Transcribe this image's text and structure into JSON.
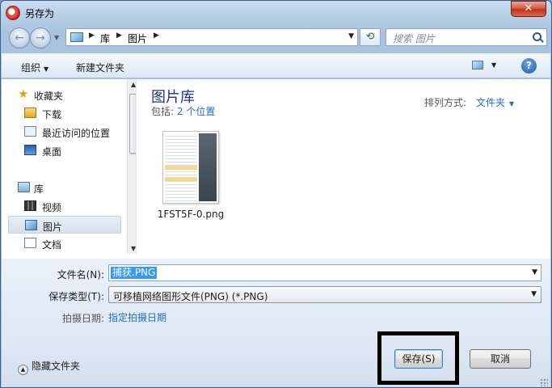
{
  "window": {
    "title": "另存为",
    "close_glyph": "✕",
    "colors": {
      "frame": "#a9c3e0",
      "close": "#c0321a",
      "link": "#1f6fc5",
      "selection": "#3399ff"
    }
  },
  "address": {
    "crumbs": [
      "库",
      "图片"
    ],
    "search_placeholder": "搜索 图片",
    "icons": {
      "back": "back-arrow-icon",
      "forward": "forward-arrow-icon",
      "refresh": "refresh-icon",
      "search": "search-icon"
    }
  },
  "toolbar": {
    "organize": "组织",
    "new_folder": "新建文件夹",
    "help": "?"
  },
  "nav": {
    "items": [
      {
        "label": "收藏夹",
        "icon": "star-icon",
        "group": true
      },
      {
        "label": "下载",
        "icon": "download-folder-icon"
      },
      {
        "label": "最近访问的位置",
        "icon": "recent-places-icon"
      },
      {
        "label": "桌面",
        "icon": "desktop-icon"
      },
      {
        "label": "库",
        "icon": "library-icon",
        "group": true
      },
      {
        "label": "视频",
        "icon": "video-icon"
      },
      {
        "label": "图片",
        "icon": "picture-icon",
        "selected": true
      },
      {
        "label": "文档",
        "icon": "document-icon"
      }
    ]
  },
  "content": {
    "library_title": "图片库",
    "includes_label": "包括:",
    "includes_locations": "2 个位置",
    "sort_label": "排列方式:",
    "sort_value": "文件夹",
    "files": [
      {
        "name": "1FST5F-0.png"
      }
    ]
  },
  "fields": {
    "filename_label": "文件名(N):",
    "filename_value": "捕获.PNG",
    "type_label": "保存类型(T):",
    "type_value": "可移植网络图形文件(PNG) (*.PNG)",
    "date_label": "拍摄日期:",
    "date_link": "指定拍摄日期"
  },
  "footer": {
    "hide_folders": "隐藏文件夹",
    "save": "保存(S)",
    "cancel": "取消"
  }
}
